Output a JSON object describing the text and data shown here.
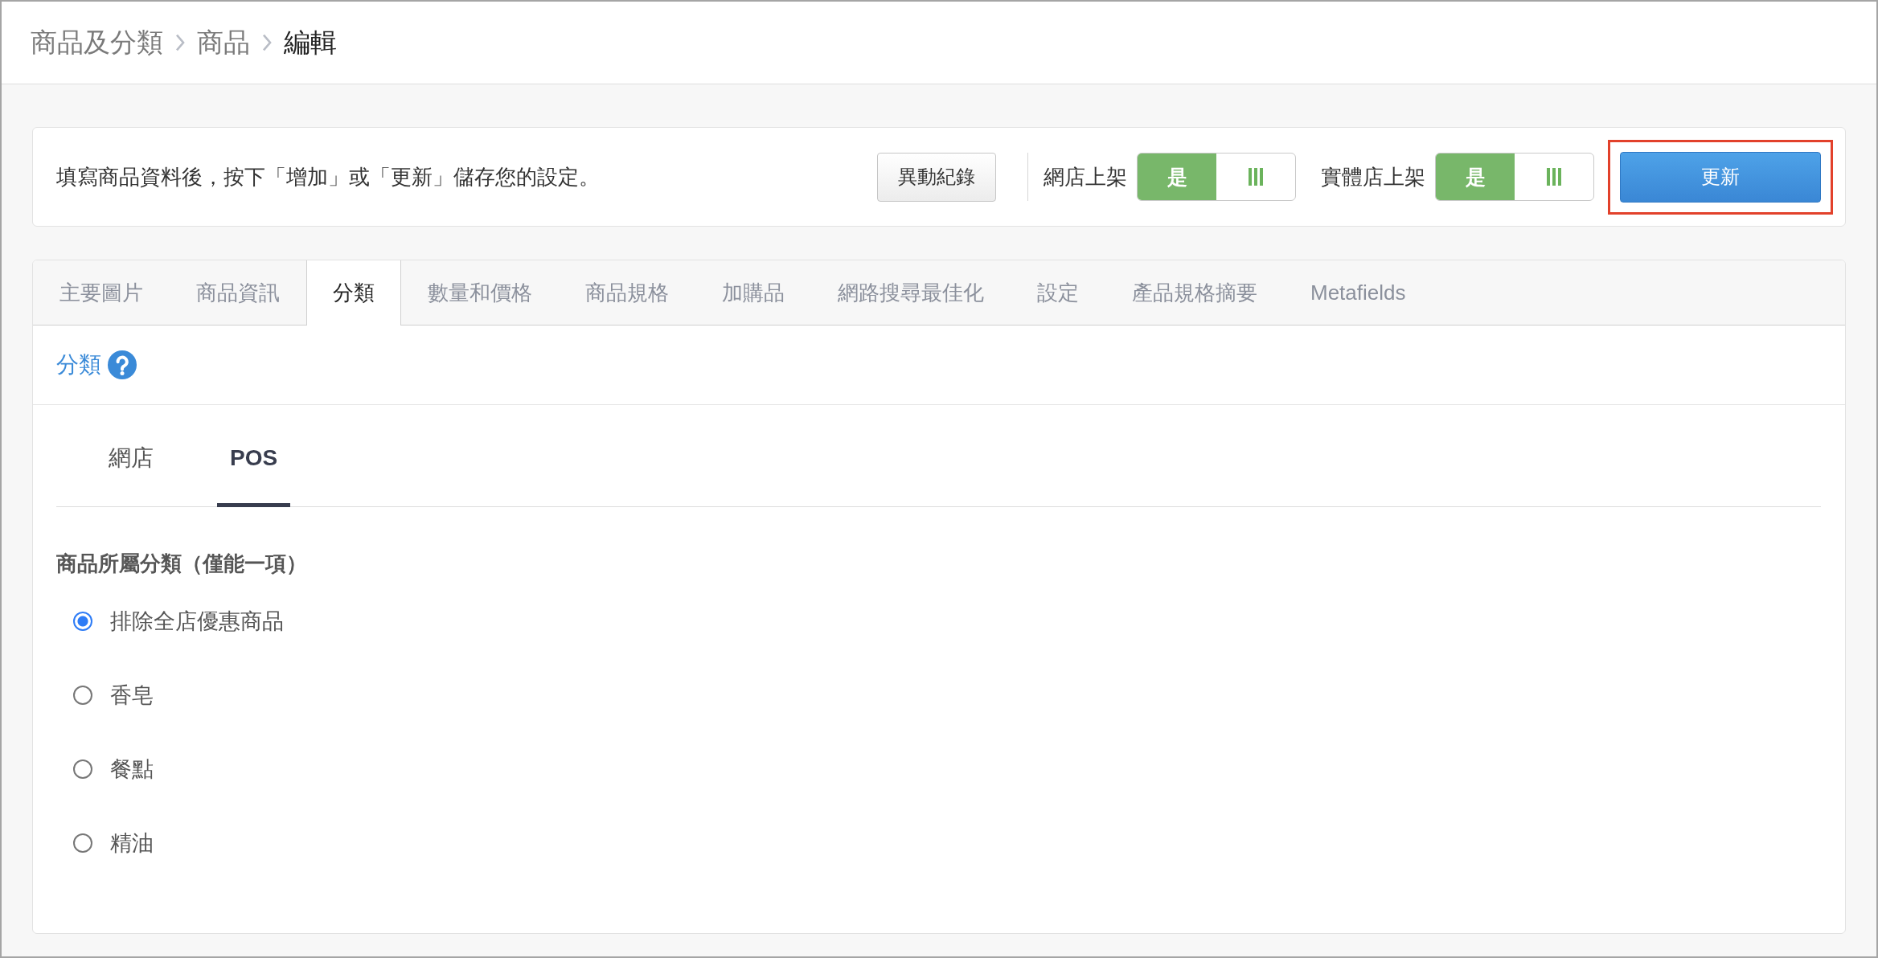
{
  "breadcrumb": [
    {
      "label": "商品及分類",
      "current": false
    },
    {
      "label": "商品",
      "current": false
    },
    {
      "label": "編輯",
      "current": true
    }
  ],
  "notice_bar": {
    "message": "填寫商品資料後，按下「增加」或「更新」儲存您的設定。",
    "history_button": "異動紀錄",
    "switches": [
      {
        "label": "網店上架",
        "on_text": "是",
        "on": true
      },
      {
        "label": "實體店上架",
        "on_text": "是",
        "on": true
      }
    ],
    "update_button": {
      "label": "更新",
      "highlighted": true
    }
  },
  "tabs": [
    {
      "label": "主要圖片",
      "selected": false
    },
    {
      "label": "商品資訊",
      "selected": false
    },
    {
      "label": "分類",
      "selected": true
    },
    {
      "label": "數量和價格",
      "selected": false
    },
    {
      "label": "商品規格",
      "selected": false
    },
    {
      "label": "加購品",
      "selected": false
    },
    {
      "label": "網路搜尋最佳化",
      "selected": false
    },
    {
      "label": "設定",
      "selected": false
    },
    {
      "label": "產品規格摘要",
      "selected": false
    },
    {
      "label": "Metafields",
      "selected": false
    }
  ],
  "section": {
    "title": "分類",
    "channel_tabs": [
      {
        "label": "網店",
        "selected": false
      },
      {
        "label": "POS",
        "selected": true
      }
    ],
    "field_label": "商品所屬分類（僅能一項）",
    "options": [
      {
        "label": "排除全店優惠商品",
        "selected": true
      },
      {
        "label": "香皂",
        "selected": false
      },
      {
        "label": "餐點",
        "selected": false
      },
      {
        "label": "精油",
        "selected": false
      }
    ]
  }
}
